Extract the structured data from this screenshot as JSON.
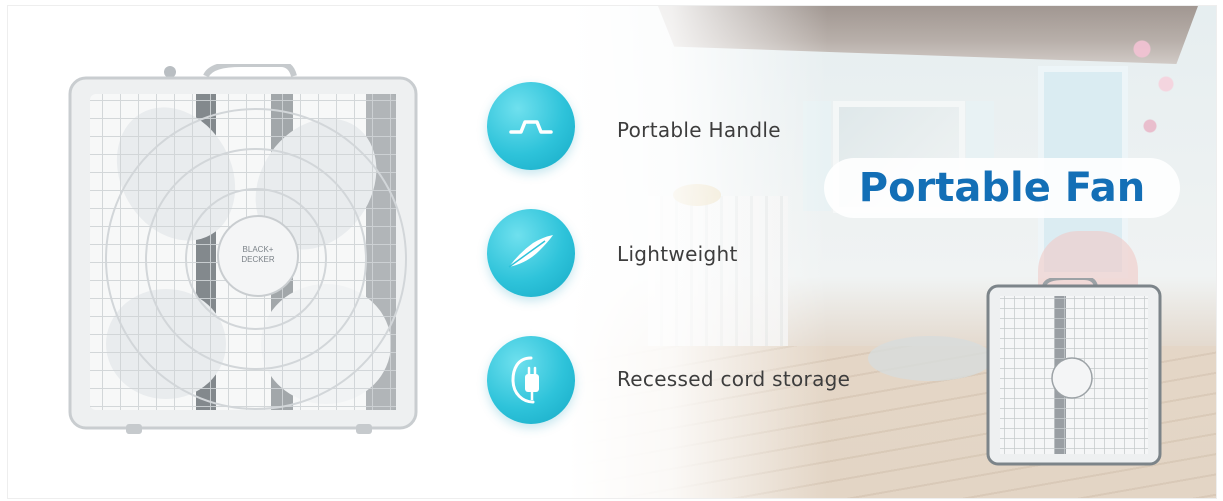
{
  "title": "Portable Fan",
  "brand_logo": "BLACK+ DECKER",
  "colors": {
    "title": "#136fb6",
    "feature_circle": "#2ec3da",
    "feature_text": "#3d3d3d"
  },
  "features": [
    {
      "label": "Portable Handle",
      "icon": "handle-icon"
    },
    {
      "label": "Lightweight",
      "icon": "feather-icon"
    },
    {
      "label": "Recessed cord storage",
      "icon": "plug-icon"
    }
  ]
}
